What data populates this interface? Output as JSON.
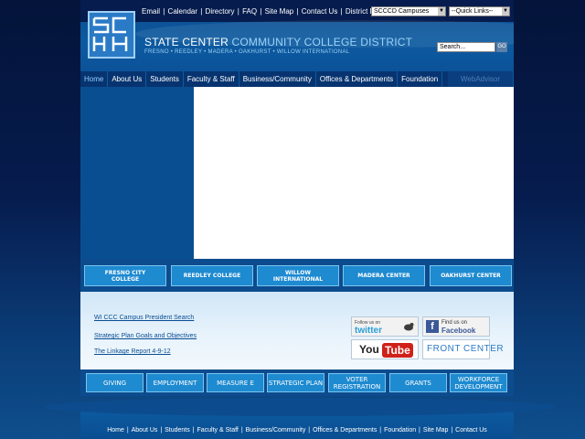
{
  "header": {
    "top_links": [
      "Email",
      "Calendar",
      "Directory",
      "FAQ",
      "Site Map",
      "Contact Us",
      "District Police"
    ],
    "campus_select": "SCCCD Campuses",
    "quick_links_select": "--Quick Links--",
    "title_part1": "STATE CENTER",
    "title_part2": "COMMUNITY COLLEGE DISTRICT",
    "tagline": "FRESNO • REEDLEY • MADERA • OAKHURST • WILLOW INTERNATIONAL",
    "search_value": "Search...",
    "go_label": "GO"
  },
  "nav": {
    "items": [
      "Home",
      "About Us",
      "Students",
      "Faculty & Staff",
      "Business/Community",
      "Offices & Departments",
      "Foundation"
    ],
    "webadvisor": "WebAdvisor"
  },
  "campuses": [
    "FRESNO CITY COLLEGE",
    "REEDLEY COLLEGE",
    "WILLOW INTERNATIONAL",
    "MADERA CENTER",
    "OAKHURST CENTER"
  ],
  "news_links": [
    "WI CCC Campus President Search",
    "Strategic Plan Goals and Objectives",
    "The Linkage Report 4-9-12"
  ],
  "social": {
    "twitter_small": "Follow us on",
    "twitter_big": "twitter",
    "facebook_small": "Find us on",
    "facebook_big": "Facebook",
    "youtube_you": "You",
    "youtube_tube": "Tube",
    "frontcenter": "FRONT CENTER"
  },
  "bottom_buttons": [
    "GIVING",
    "EMPLOYMENT",
    "MEASURE E",
    "STRATEGIC PLAN",
    "VOTER REGISTRATION",
    "GRANTS",
    "WORKFORCE DEVELOPMENT"
  ],
  "footer": {
    "links": [
      "Home",
      "About Us",
      "Students",
      "Faculty & Staff",
      "Business/Community",
      "Offices & Departments",
      "Foundation",
      "Site Map",
      "Contact Us"
    ]
  }
}
